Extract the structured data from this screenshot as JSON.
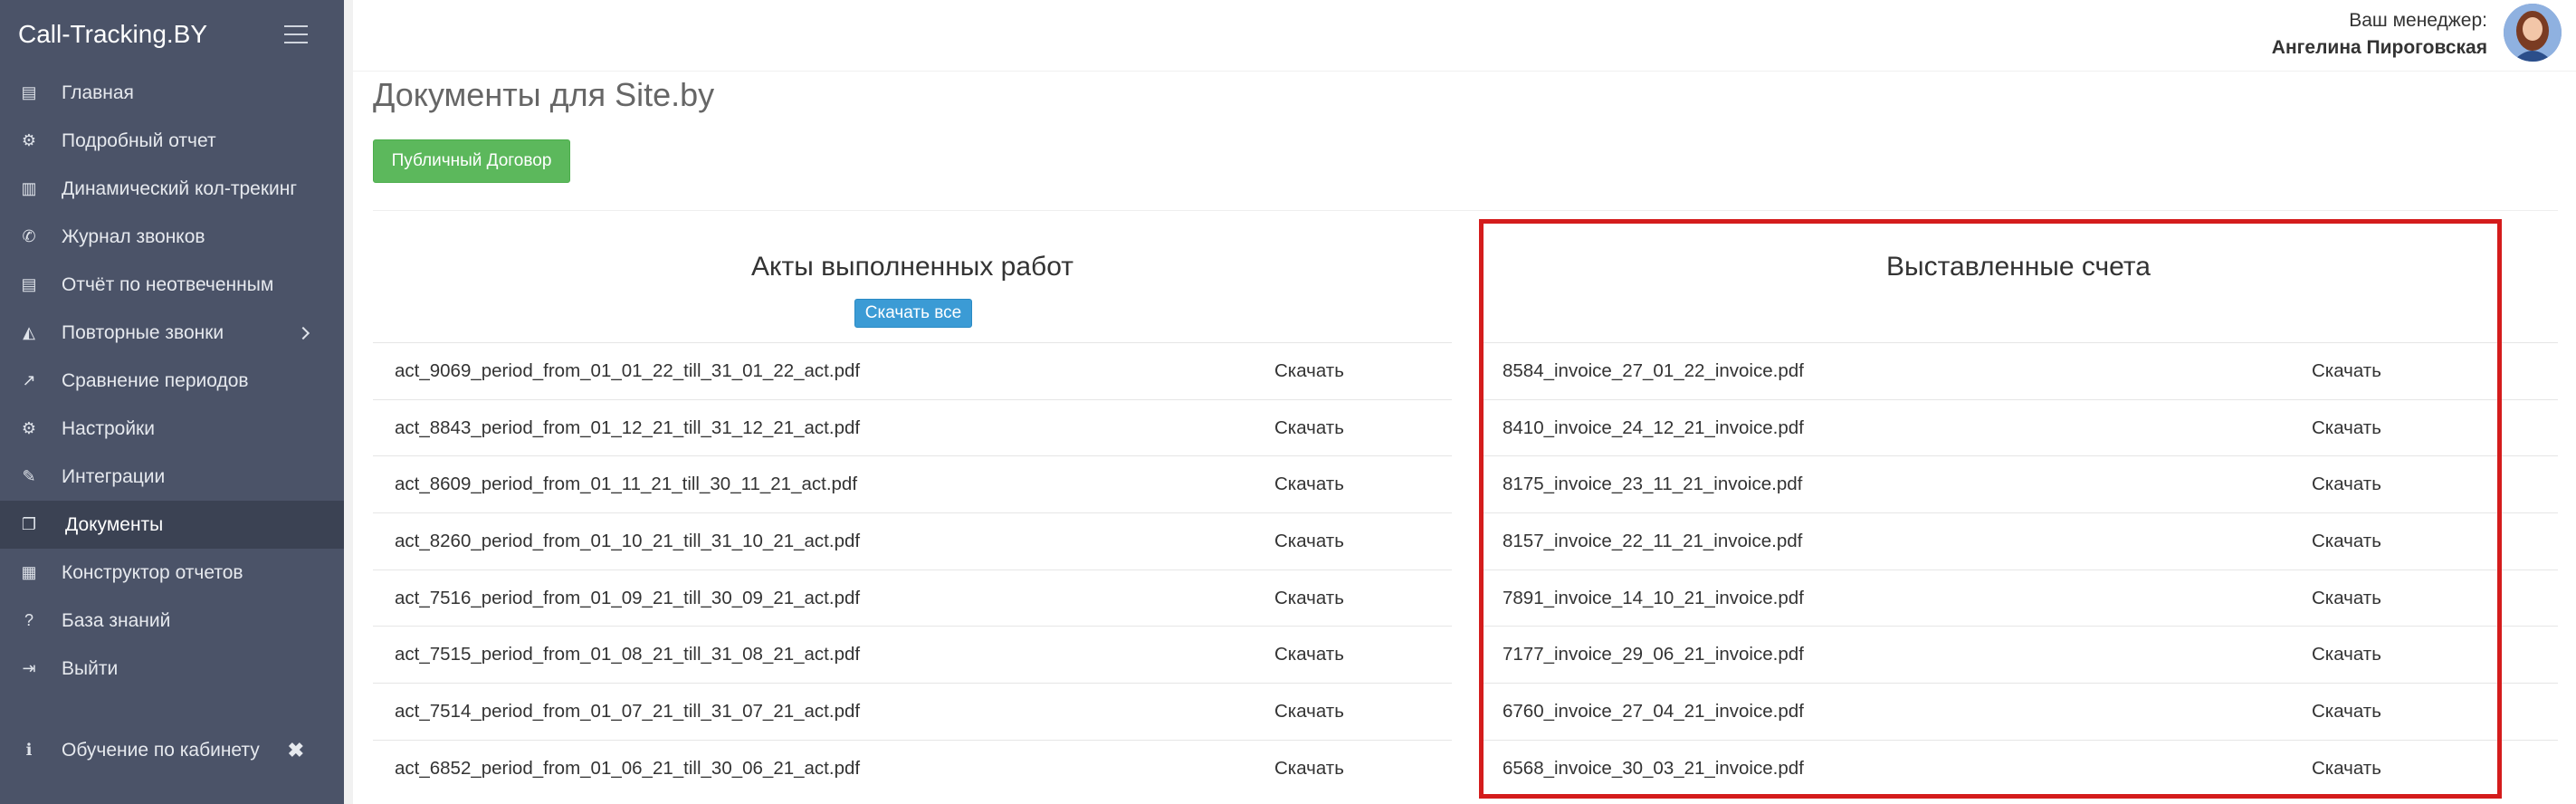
{
  "sidebar": {
    "brand": "Call-Tracking.BY",
    "items": [
      {
        "label": "Главная",
        "icon": "home-icon",
        "glyph": "▤"
      },
      {
        "label": "Подробный отчет",
        "icon": "report-icon",
        "glyph": "⚙"
      },
      {
        "label": "Динамический кол-трекинг",
        "icon": "bar-chart-icon",
        "glyph": "▥"
      },
      {
        "label": "Журнал звонков",
        "icon": "phone-icon",
        "glyph": "✆"
      },
      {
        "label": "Отчёт по неотвеченным",
        "icon": "document-icon",
        "glyph": "▤"
      },
      {
        "label": "Повторные звонки",
        "icon": "area-chart-icon",
        "glyph": "◭"
      },
      {
        "label": "Сравнение периодов",
        "icon": "line-chart-icon",
        "glyph": "↗"
      },
      {
        "label": "Настройки",
        "icon": "settings-icon",
        "glyph": "⚙"
      },
      {
        "label": "Интеграции",
        "icon": "plug-icon",
        "glyph": "✎"
      },
      {
        "label": "Документы",
        "icon": "documents-icon",
        "glyph": "❐"
      },
      {
        "label": "Конструктор отчетов",
        "icon": "report-builder-icon",
        "glyph": "▦"
      },
      {
        "label": "База знаний",
        "icon": "question-icon",
        "glyph": "?"
      },
      {
        "label": "Выйти",
        "icon": "logout-icon",
        "glyph": "⇥"
      }
    ],
    "bottom_item": {
      "label": "Обучение по кабинету",
      "icon": "info-icon",
      "glyph": "ℹ",
      "close": "✖"
    }
  },
  "header": {
    "manager_label": "Ваш менеджер:",
    "manager_name": "Ангелина Пироговская"
  },
  "main": {
    "title": "Документы для Site.by",
    "public_contract_button": "Публичный Договор",
    "acts": {
      "title": "Акты выполненных работ",
      "download_all": "Скачать все",
      "rows": [
        {
          "file": "act_9069_period_from_01_01_22_till_31_01_22_act.pdf",
          "action": "Скачать"
        },
        {
          "file": "act_8843_period_from_01_12_21_till_31_12_21_act.pdf",
          "action": "Скачать"
        },
        {
          "file": "act_8609_period_from_01_11_21_till_30_11_21_act.pdf",
          "action": "Скачать"
        },
        {
          "file": "act_8260_period_from_01_10_21_till_31_10_21_act.pdf",
          "action": "Скачать"
        },
        {
          "file": "act_7516_period_from_01_09_21_till_30_09_21_act.pdf",
          "action": "Скачать"
        },
        {
          "file": "act_7515_period_from_01_08_21_till_31_08_21_act.pdf",
          "action": "Скачать"
        },
        {
          "file": "act_7514_period_from_01_07_21_till_31_07_21_act.pdf",
          "action": "Скачать"
        },
        {
          "file": "act_6852_period_from_01_06_21_till_30_06_21_act.pdf",
          "action": "Скачать"
        }
      ]
    },
    "invoices": {
      "title": "Выставленные счета",
      "rows": [
        {
          "file": "8584_invoice_27_01_22_invoice.pdf",
          "action": "Скачать"
        },
        {
          "file": "8410_invoice_24_12_21_invoice.pdf",
          "action": "Скачать"
        },
        {
          "file": "8175_invoice_23_11_21_invoice.pdf",
          "action": "Скачать"
        },
        {
          "file": "8157_invoice_22_11_21_invoice.pdf",
          "action": "Скачать"
        },
        {
          "file": "7891_invoice_14_10_21_invoice.pdf",
          "action": "Скачать"
        },
        {
          "file": "7177_invoice_29_06_21_invoice.pdf",
          "action": "Скачать"
        },
        {
          "file": "6760_invoice_27_04_21_invoice.pdf",
          "action": "Скачать"
        },
        {
          "file": "6568_invoice_30_03_21_invoice.pdf",
          "action": "Скачать"
        }
      ]
    }
  },
  "colors": {
    "sidebar_bg": "#4b5368",
    "active_item_bg": "#3b4253",
    "green_button": "#5cb85c",
    "blue_button": "#3b9bd5",
    "highlight_border": "#d41c1c"
  }
}
